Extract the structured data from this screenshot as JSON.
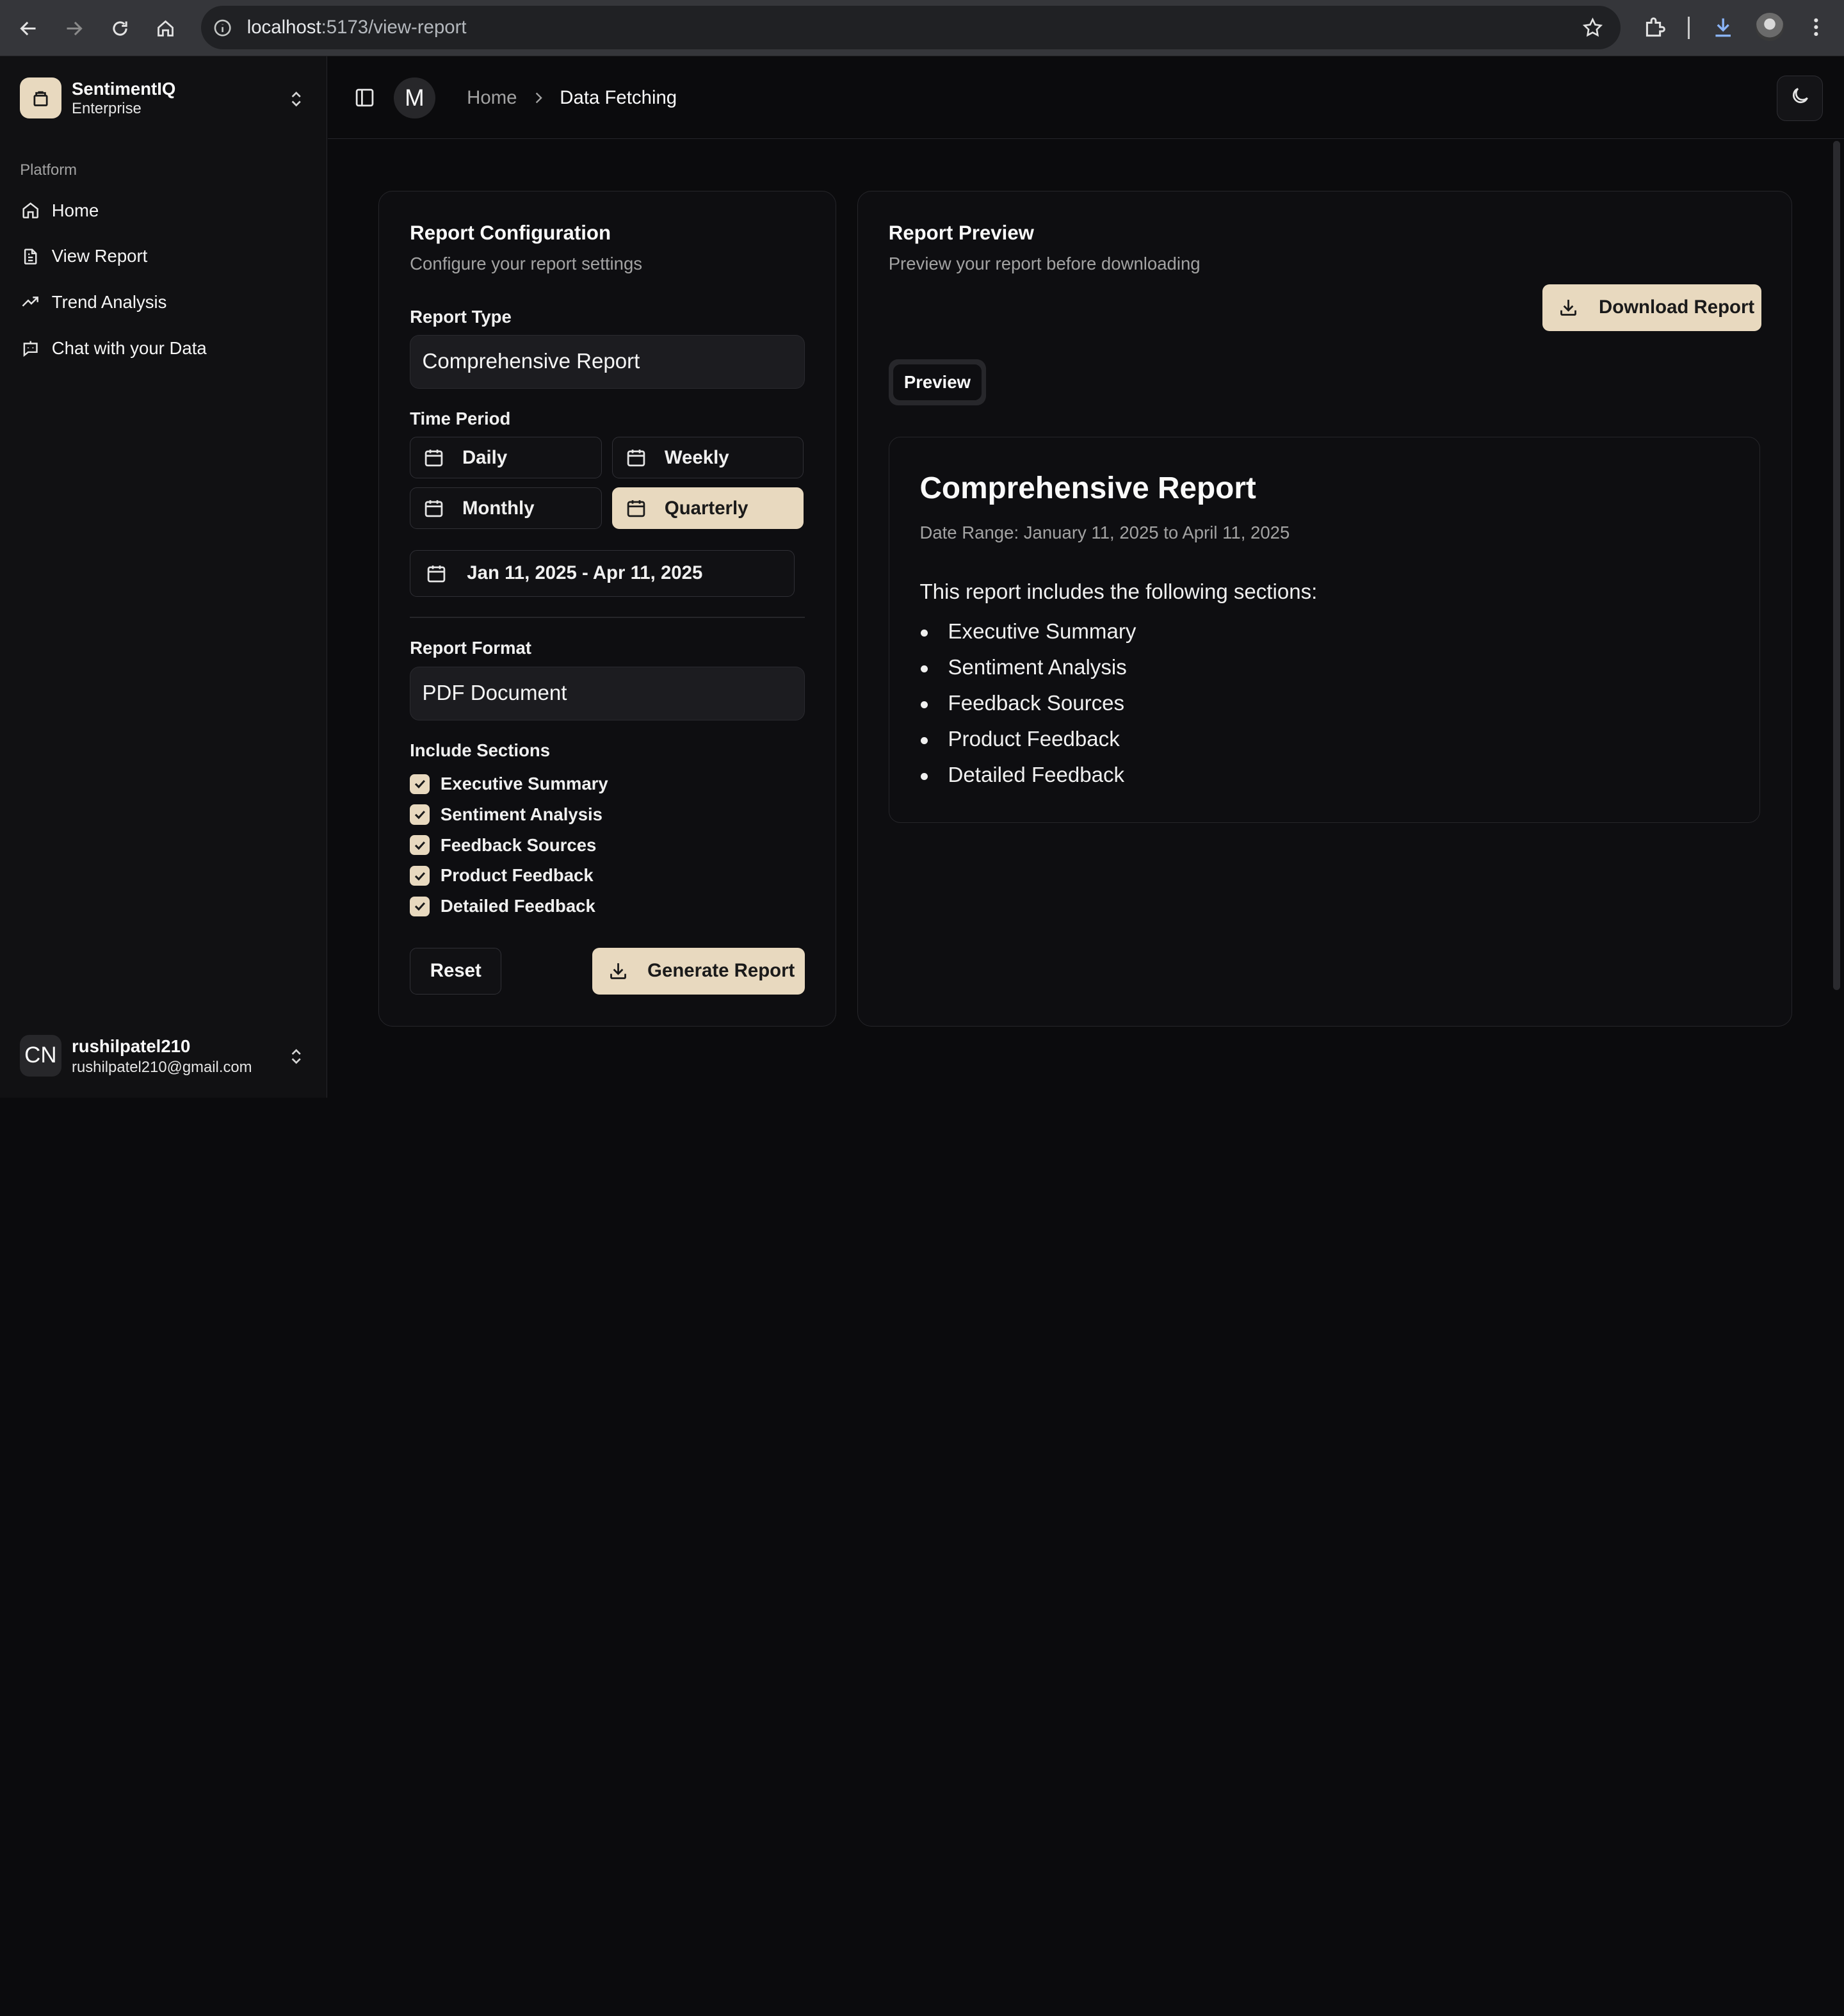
{
  "browser": {
    "url_host": "localhost",
    "url_path": ":5173/view-report"
  },
  "sidebar": {
    "team_name": "SentimentIQ",
    "team_plan": "Enterprise",
    "group_label": "Platform",
    "items": [
      {
        "label": "Home",
        "icon": "home-icon"
      },
      {
        "label": "View Report",
        "icon": "file-text-icon"
      },
      {
        "label": "Trend Analysis",
        "icon": "trending-up-icon"
      },
      {
        "label": "Chat with your Data",
        "icon": "chat-bot-icon"
      }
    ],
    "user": {
      "initials": "CN",
      "name": "rushilpatel210",
      "email": "rushilpatel210@gmail.com"
    }
  },
  "header": {
    "avatar_initial": "M",
    "breadcrumb_home": "Home",
    "breadcrumb_current": "Data Fetching"
  },
  "config": {
    "title": "Report Configuration",
    "description": "Configure your report settings",
    "report_type_label": "Report Type",
    "report_type_value": "Comprehensive Report",
    "time_period_label": "Time Period",
    "periods": [
      "Daily",
      "Weekly",
      "Monthly",
      "Quarterly"
    ],
    "active_period": "Quarterly",
    "date_range": "Jan 11, 2025 - Apr 11, 2025",
    "format_label": "Report Format",
    "format_value": "PDF Document",
    "sections_label": "Include Sections",
    "sections": [
      {
        "label": "Executive Summary",
        "checked": true
      },
      {
        "label": "Sentiment Analysis",
        "checked": true
      },
      {
        "label": "Feedback Sources",
        "checked": true
      },
      {
        "label": "Product Feedback",
        "checked": true
      },
      {
        "label": "Detailed Feedback",
        "checked": true
      }
    ],
    "reset_label": "Reset",
    "generate_label": "Generate Report"
  },
  "preview": {
    "title": "Report Preview",
    "description": "Preview your report before downloading",
    "download_label": "Download Report",
    "tab_label": "Preview",
    "doc_title": "Comprehensive Report",
    "doc_range": "Date Range: January 11, 2025 to April 11, 2025",
    "doc_intro": "This report includes the following sections:",
    "doc_sections": [
      "Executive Summary",
      "Sentiment Analysis",
      "Feedback Sources",
      "Product Feedback",
      "Detailed Feedback"
    ]
  },
  "colors": {
    "accent": "#e8d9bf",
    "background": "#0b0b0d",
    "sidebar": "#111113"
  }
}
